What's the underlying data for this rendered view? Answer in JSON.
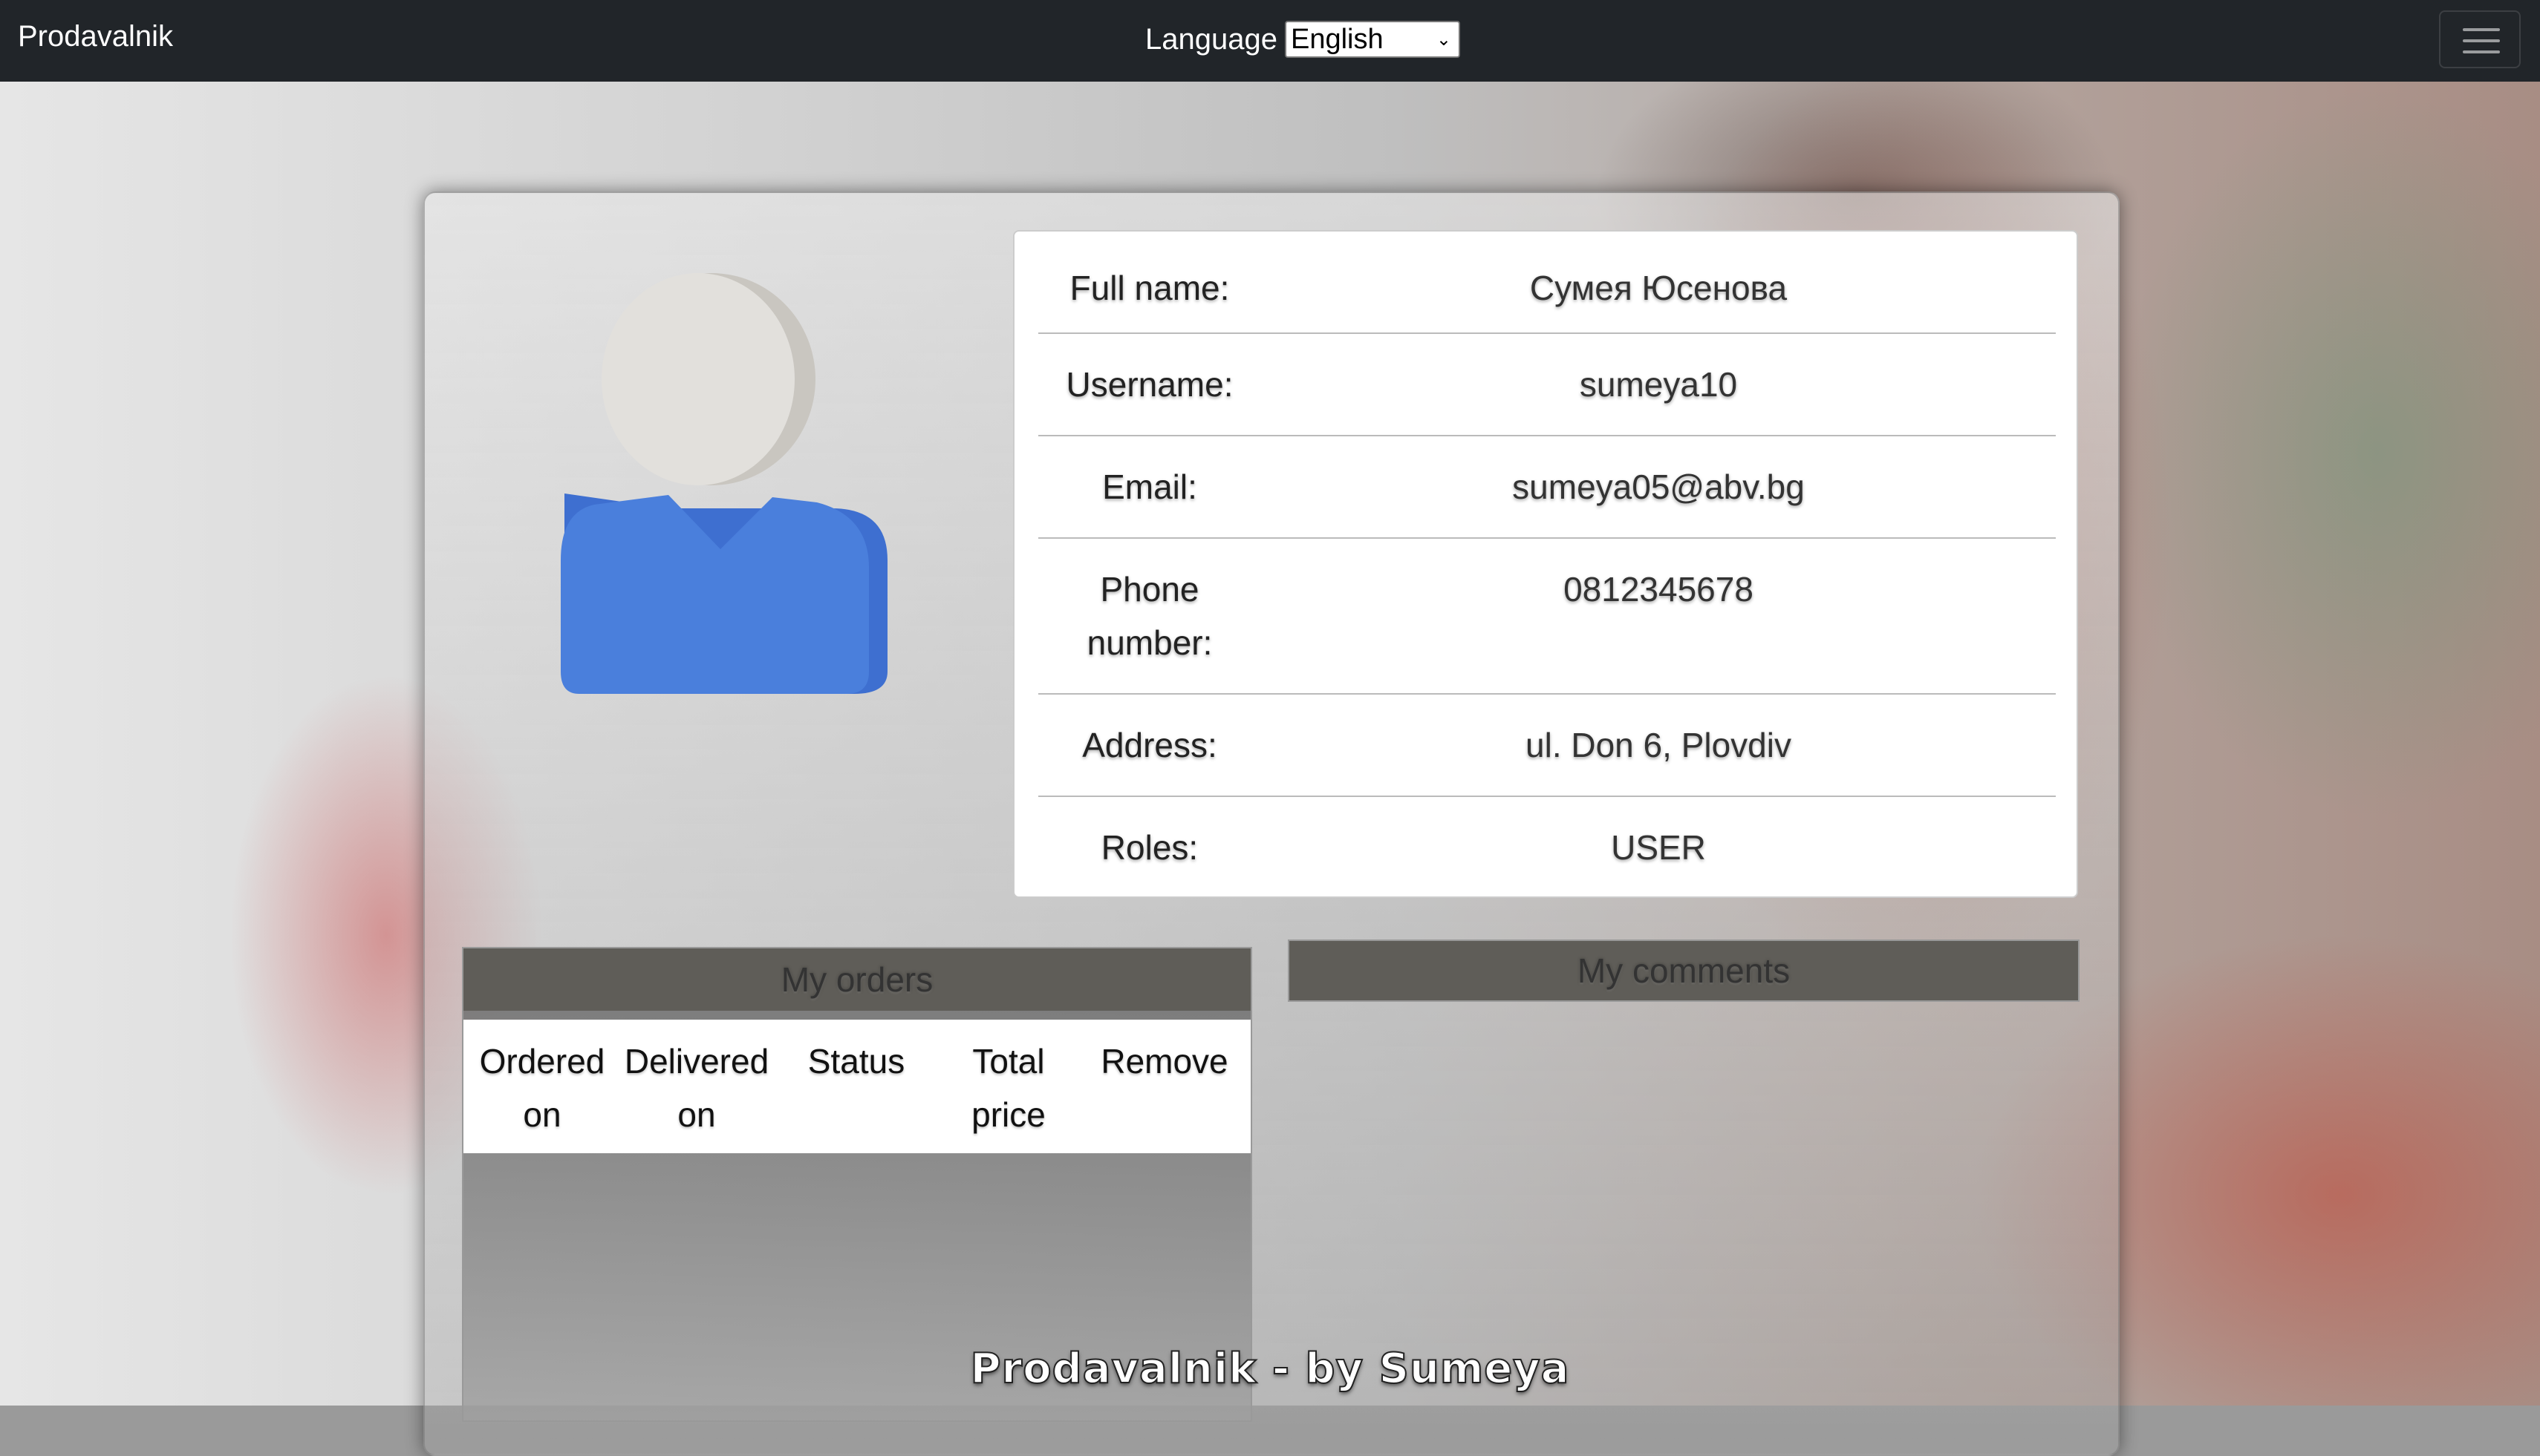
{
  "navbar": {
    "brand": "Prodavalnik",
    "language_label": "Language",
    "language_selected": "English"
  },
  "profile": {
    "rows": [
      {
        "label": "Full name:",
        "value": "Сумея Юсенова"
      },
      {
        "label": "Username:",
        "value": "sumeya10"
      },
      {
        "label": "Email:",
        "value": "sumeya05@abv.bg"
      },
      {
        "label": "Phone number:",
        "value": "0812345678"
      },
      {
        "label": "Address:",
        "value": "ul. Don 6, Plovdiv"
      },
      {
        "label": "Roles:",
        "value": "USER"
      }
    ]
  },
  "orders": {
    "title": "My orders",
    "columns": [
      "Ordered on",
      "Delivered on",
      "Status",
      "Total price",
      "Remove"
    ]
  },
  "comments": {
    "title": "My comments"
  },
  "footer": {
    "text": "Prodavalnik - by Sumeya"
  },
  "colors": {
    "navbar": "#212529",
    "avatar_body": "#4a7fdc",
    "avatar_head": "#e2e0dc",
    "section_header": "#5f5d58"
  }
}
